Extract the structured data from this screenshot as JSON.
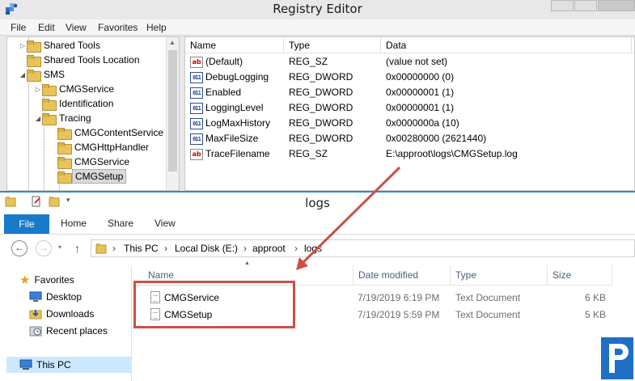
{
  "registry": {
    "title": "Registry Editor",
    "menu": [
      "File",
      "Edit",
      "View",
      "Favorites",
      "Help"
    ],
    "tree": [
      {
        "label": "Shared Tools",
        "expander": "▷"
      },
      {
        "label": "Shared Tools Location",
        "expander": ""
      },
      {
        "label": "SMS",
        "expander": "◢"
      },
      {
        "label": "CMGService",
        "expander": "▷"
      },
      {
        "label": "Identification",
        "expander": ""
      },
      {
        "label": "Tracing",
        "expander": "◢"
      },
      {
        "label": "CMGContentService",
        "expander": ""
      },
      {
        "label": "CMGHttpHandler",
        "expander": ""
      },
      {
        "label": "CMGService",
        "expander": ""
      },
      {
        "label": "CMGSetup",
        "expander": "",
        "selected": true
      }
    ],
    "columns": [
      "Name",
      "Type",
      "Data"
    ],
    "values": [
      {
        "icon": "string-value-icon",
        "glyph": "ab",
        "name": "(Default)",
        "type": "REG_SZ",
        "data": "(value not set)"
      },
      {
        "icon": "dword-value-icon",
        "glyph": "011",
        "name": "DebugLogging",
        "type": "REG_DWORD",
        "data": "0x00000000 (0)"
      },
      {
        "icon": "dword-value-icon",
        "glyph": "011",
        "name": "Enabled",
        "type": "REG_DWORD",
        "data": "0x00000001 (1)"
      },
      {
        "icon": "dword-value-icon",
        "glyph": "011",
        "name": "LoggingLevel",
        "type": "REG_DWORD",
        "data": "0x00000001 (1)"
      },
      {
        "icon": "dword-value-icon",
        "glyph": "011",
        "name": "LogMaxHistory",
        "type": "REG_DWORD",
        "data": "0x0000000a (10)"
      },
      {
        "icon": "dword-value-icon",
        "glyph": "011",
        "name": "MaxFileSize",
        "type": "REG_DWORD",
        "data": "0x00280000 (2621440)"
      },
      {
        "icon": "string-value-icon",
        "glyph": "ab",
        "name": "TraceFilename",
        "type": "REG_SZ",
        "data": "E:\\approot\\logs\\CMGSetup.log"
      }
    ]
  },
  "explorer": {
    "title": "logs",
    "ribbon_tabs": [
      "File",
      "Home",
      "Share",
      "View"
    ],
    "breadcrumb": [
      "This PC",
      "Local Disk (E:)",
      "approot",
      "logs"
    ],
    "nav": [
      {
        "icon": "favorites-star-icon",
        "label": "Favorites"
      },
      {
        "icon": "desktop-icon",
        "label": "Desktop"
      },
      {
        "icon": "downloads-icon",
        "label": "Downloads"
      },
      {
        "icon": "recent-places-icon",
        "label": "Recent places"
      }
    ],
    "nav_selected": "This PC",
    "columns": [
      "Name",
      "Date modified",
      "Type",
      "Size"
    ],
    "files": [
      {
        "name": "CMGService",
        "date": "7/19/2019 6:19 PM",
        "type": "Text Document",
        "size": "6 KB"
      },
      {
        "name": "CMGSetup",
        "date": "7/19/2019 5:59 PM",
        "type": "Text Document",
        "size": "5 KB"
      }
    ]
  },
  "colors": {
    "annotation": "#cd4f43",
    "file_tab": "#1979ca",
    "logo": "#1f6fc5",
    "selection": "#cce8ff"
  }
}
